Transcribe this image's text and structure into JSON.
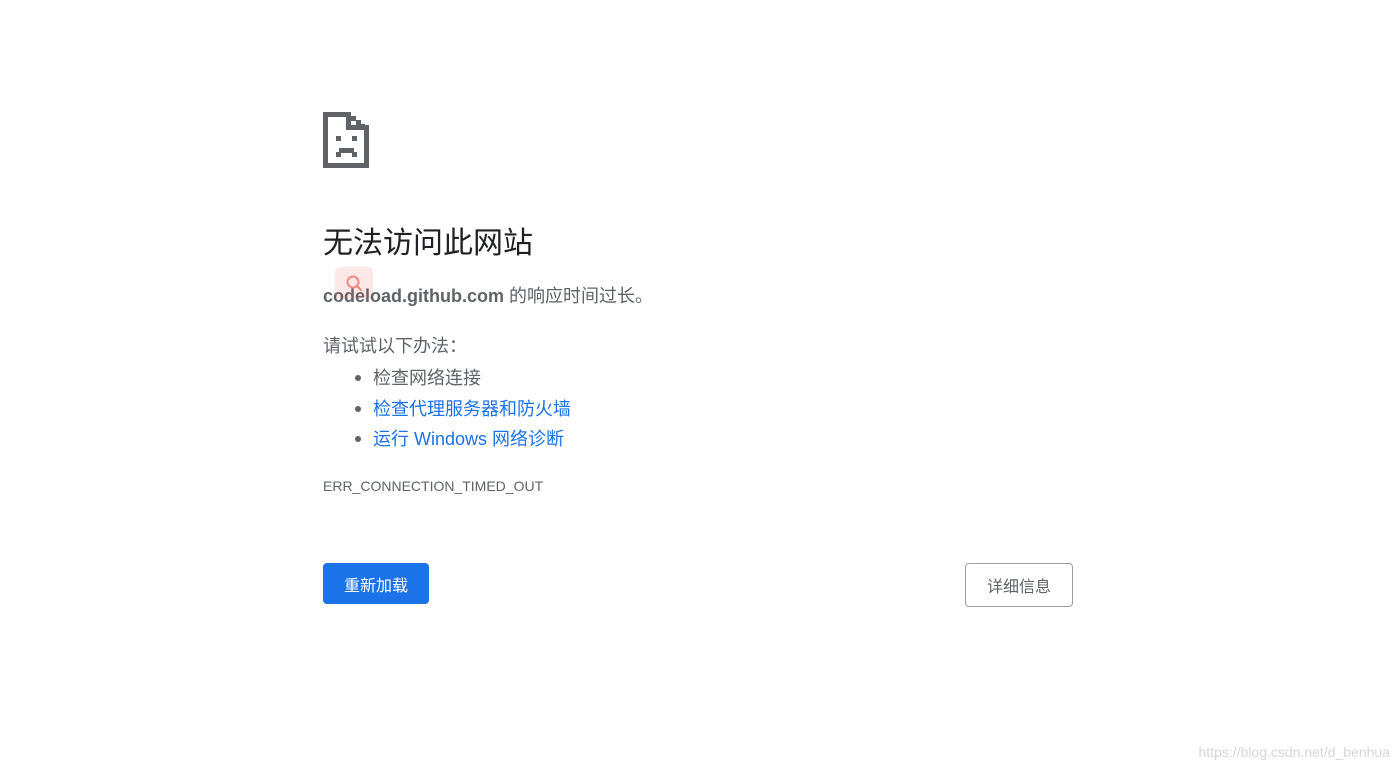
{
  "page": {
    "title": "无法访问此网站",
    "summary": {
      "host": "codeload.github.com",
      "message": " 的响应时间过长。"
    },
    "suggestions": {
      "heading": "请试试以下办法：",
      "items": [
        {
          "label": "检查网络连接",
          "is_link": false
        },
        {
          "label": "检查代理服务器和防火墙",
          "is_link": true
        },
        {
          "label": "运行 Windows 网络诊断",
          "is_link": true
        }
      ]
    },
    "error_code": "ERR_CONNECTION_TIMED_OUT",
    "buttons": {
      "reload": "重新加载",
      "details": "详细信息"
    },
    "watermark": "https://blog.csdn.net/d_benhua"
  },
  "colors": {
    "accent": "#1a73e8",
    "text": "#5f6368",
    "title": "#202124",
    "icon": "#5f6368"
  },
  "icons": {
    "error": "sad-document-icon",
    "badge": "search-icon"
  }
}
